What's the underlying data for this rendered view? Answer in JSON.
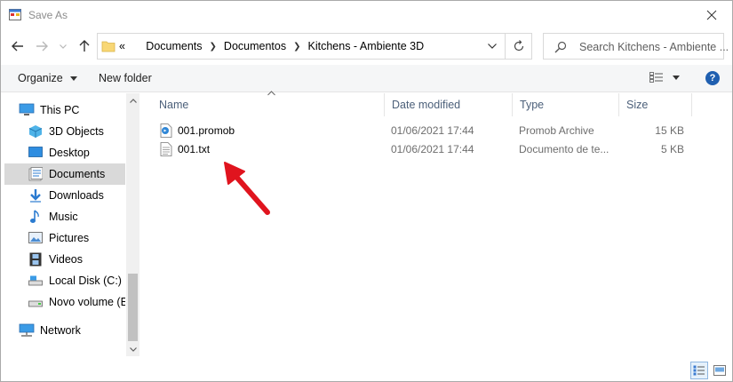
{
  "window": {
    "title": "Save As"
  },
  "address": {
    "overflow_symbol": "«",
    "crumbs": [
      "Documents",
      "Documentos",
      "Kitchens - Ambiente 3D"
    ]
  },
  "search": {
    "placeholder": "Search Kitchens - Ambiente ..."
  },
  "toolbar": {
    "organize_label": "Organize",
    "new_folder_label": "New folder",
    "help_label": "?"
  },
  "sidebar": {
    "items": [
      {
        "label": "This PC",
        "icon": "computer-icon"
      },
      {
        "label": "3D Objects",
        "icon": "cube-icon"
      },
      {
        "label": "Desktop",
        "icon": "desktop-icon"
      },
      {
        "label": "Documents",
        "icon": "documents-icon",
        "selected": true
      },
      {
        "label": "Downloads",
        "icon": "download-arrow-icon"
      },
      {
        "label": "Music",
        "icon": "music-note-icon"
      },
      {
        "label": "Pictures",
        "icon": "pictures-icon"
      },
      {
        "label": "Videos",
        "icon": "film-icon"
      },
      {
        "label": "Local Disk (C:)",
        "icon": "drive-icon"
      },
      {
        "label": "Novo volume (E",
        "icon": "drive-icon"
      },
      {
        "label": "Network",
        "icon": "network-icon"
      }
    ]
  },
  "columns": {
    "name": "Name",
    "date": "Date modified",
    "type": "Type",
    "size": "Size"
  },
  "files": [
    {
      "name": "001.promob",
      "date": "01/06/2021 17:44",
      "type": "Promob Archive",
      "size": "15 KB",
      "icon": "promob-file-icon"
    },
    {
      "name": "001.txt",
      "date": "01/06/2021 17:44",
      "type": "Documento de te...",
      "size": "5 KB",
      "icon": "text-file-icon"
    }
  ],
  "colors": {
    "selected_bg": "#d9d9d9",
    "header_text": "#4c607a",
    "annotation_red": "#e0141e",
    "accent_blue": "#1f5fb0"
  }
}
